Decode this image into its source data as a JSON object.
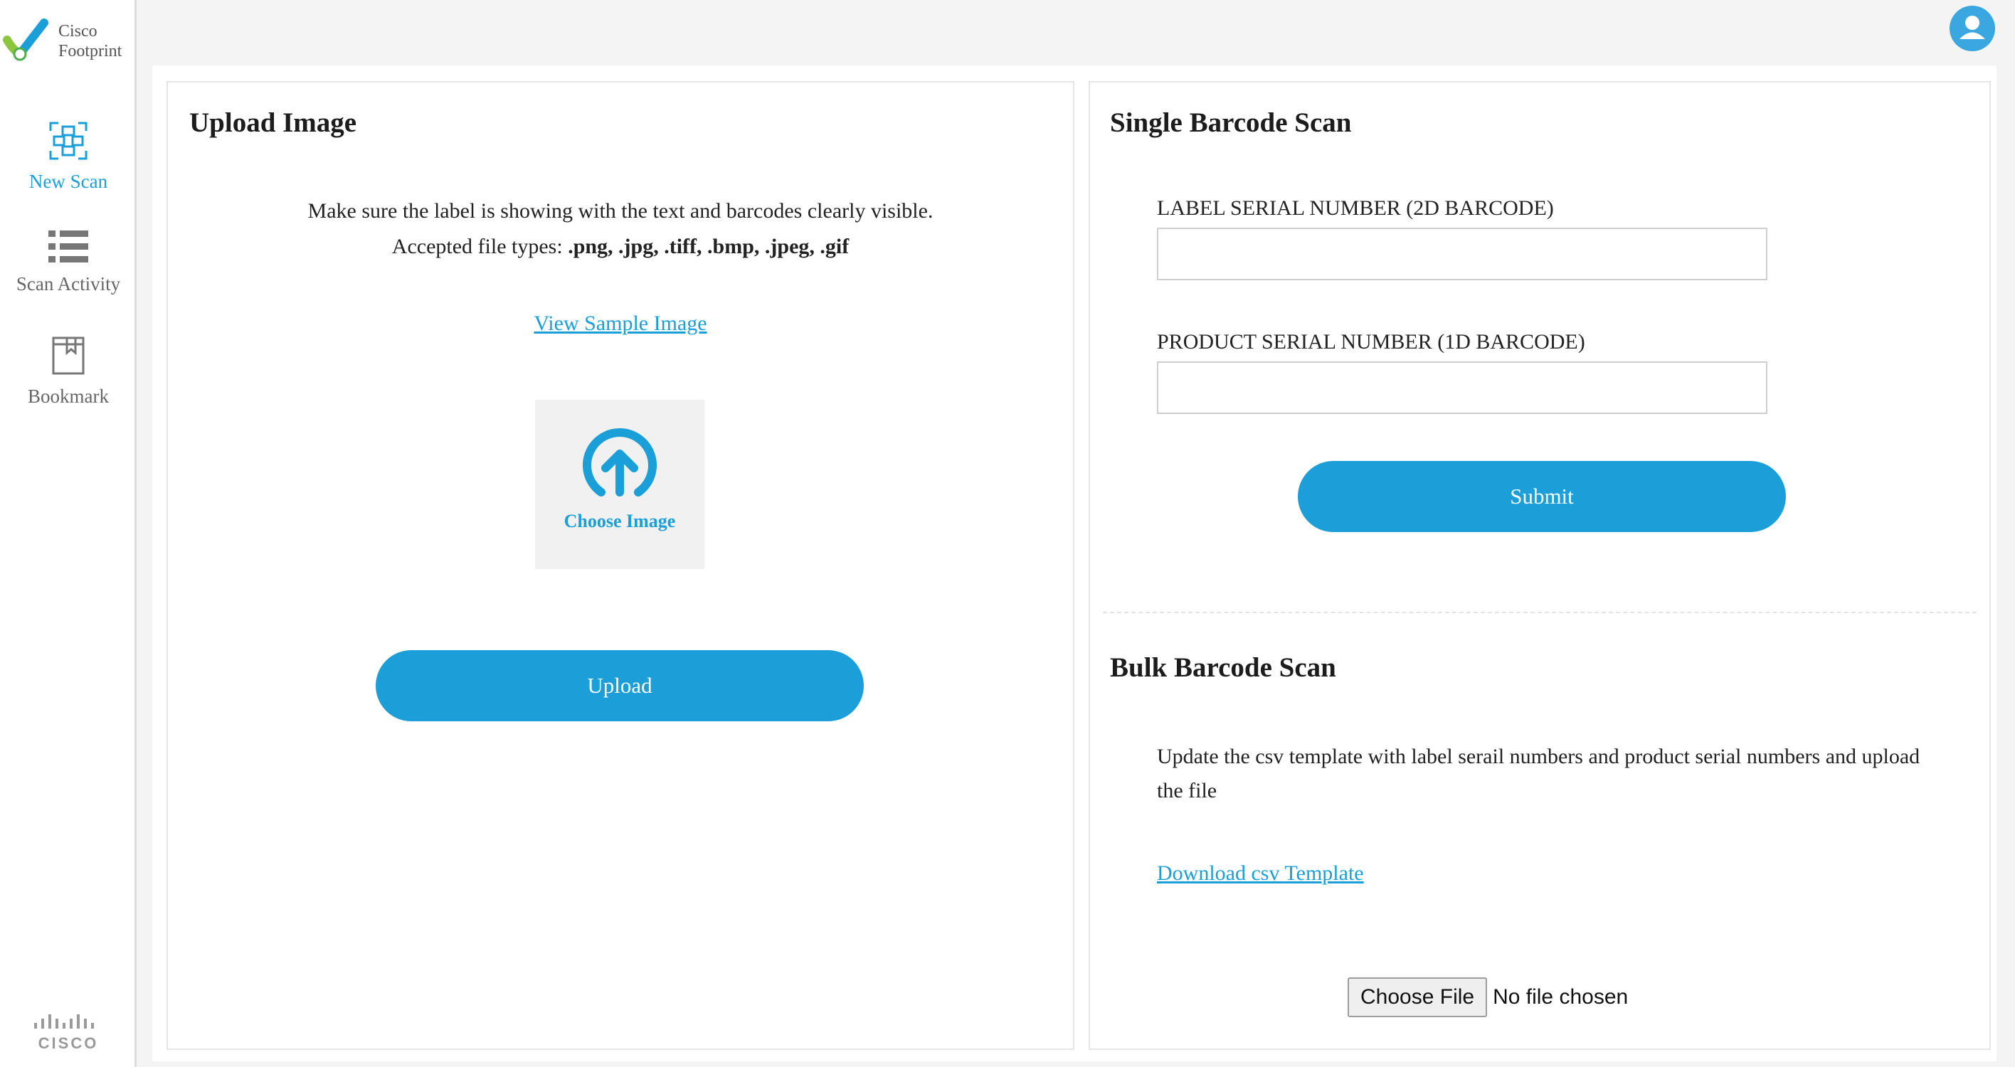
{
  "brand": {
    "line1": "Cisco",
    "line2": "Footprint"
  },
  "sidebar": {
    "items": [
      {
        "label": "New Scan",
        "icon": "scan-icon",
        "active": true
      },
      {
        "label": "Scan Activity",
        "icon": "list-icon",
        "active": false
      },
      {
        "label": "Bookmark",
        "icon": "bookmark-icon",
        "active": false
      }
    ],
    "footer_logo": "CISCO"
  },
  "header": {
    "avatar_icon": "user-icon"
  },
  "upload": {
    "title": "Upload Image",
    "instruction": "Make sure the label is showing with the text and barcodes clearly visible.",
    "accepted_label": "Accepted file types: ",
    "accepted_types": ".png, .jpg, .tiff, .bmp, .jpeg, .gif",
    "sample_link": "View Sample Image",
    "choose_label": "Choose Image",
    "upload_button": "Upload"
  },
  "single_scan": {
    "title": "Single Barcode Scan",
    "label_serial": "LABEL SERIAL NUMBER (2D BARCODE)",
    "label_serial_value": "",
    "product_serial": "PRODUCT SERIAL NUMBER (1D BARCODE)",
    "product_serial_value": "",
    "submit_button": "Submit"
  },
  "bulk_scan": {
    "title": "Bulk Barcode Scan",
    "description": "Update the csv template with label serail numbers and product serial numbers and upload the file",
    "download_link": "Download csv Template",
    "file_button": "Choose File",
    "file_status": "No file chosen"
  },
  "colors": {
    "accent": "#1c9fd8",
    "avatar": "#3aa7e0"
  }
}
